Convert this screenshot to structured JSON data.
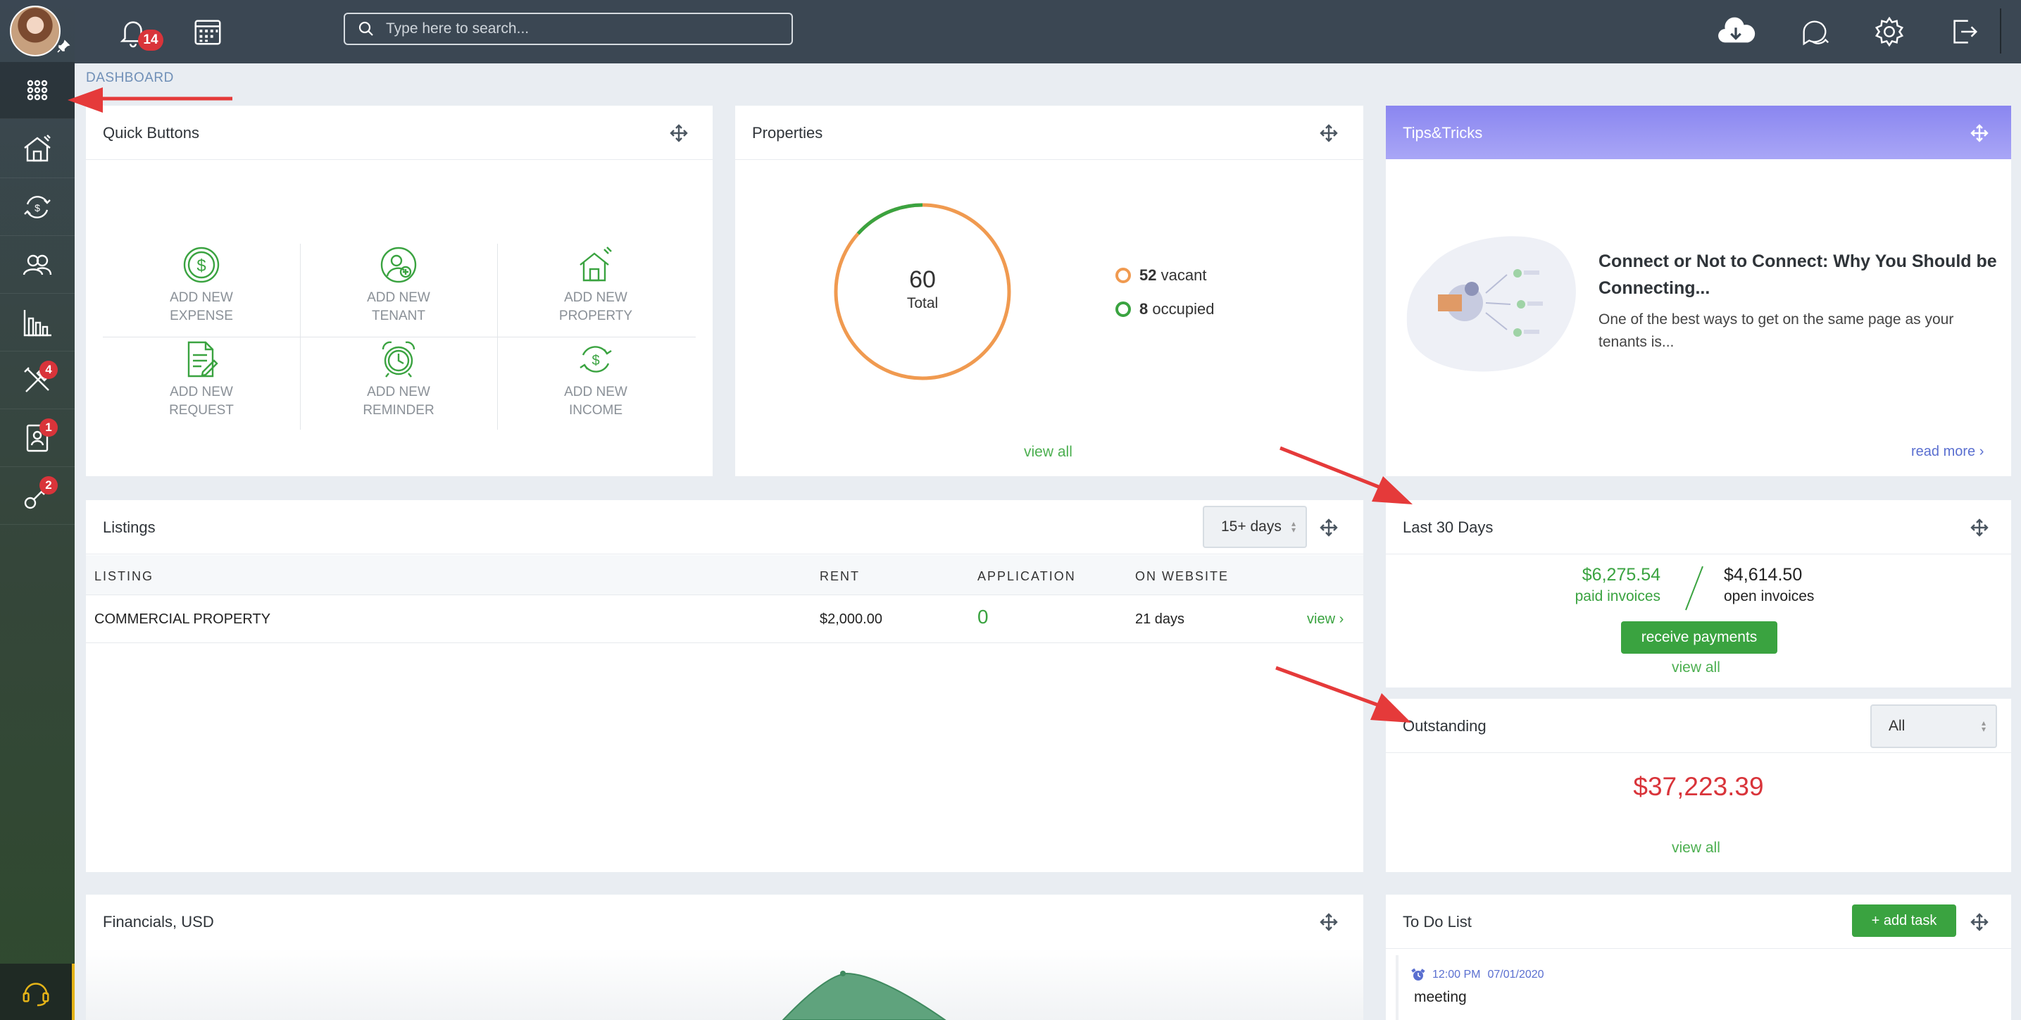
{
  "colors": {
    "accent_green": "#3aa340",
    "alert_red": "#d9343a",
    "vacant_orange": "#f09a50",
    "sidebar": "#3b4753"
  },
  "topbar": {
    "notification_count": "14",
    "search_placeholder": "Type here to search..."
  },
  "sidebar": {
    "items": [
      {
        "icon": "apps-grid-icon",
        "badge": ""
      },
      {
        "icon": "home-icon",
        "badge": ""
      },
      {
        "icon": "money-exchange-icon",
        "badge": ""
      },
      {
        "icon": "people-icon",
        "badge": ""
      },
      {
        "icon": "bar-chart-icon",
        "badge": ""
      },
      {
        "icon": "tools-icon",
        "badge": "4"
      },
      {
        "icon": "contact-card-icon",
        "badge": "1"
      },
      {
        "icon": "key-icon",
        "badge": "2"
      }
    ]
  },
  "breadcrumb": "DASHBOARD",
  "quick_buttons": {
    "title": "Quick Buttons",
    "items": [
      {
        "line1": "ADD NEW",
        "line2": "EXPENSE",
        "icon": "dollar-circle-icon"
      },
      {
        "line1": "ADD NEW",
        "line2": "TENANT",
        "icon": "add-user-icon"
      },
      {
        "line1": "ADD NEW",
        "line2": "PROPERTY",
        "icon": "add-house-icon"
      },
      {
        "line1": "ADD NEW",
        "line2": "REQUEST",
        "icon": "request-form-icon"
      },
      {
        "line1": "ADD NEW",
        "line2": "REMINDER",
        "icon": "alarm-clock-icon"
      },
      {
        "line1": "ADD NEW",
        "line2": "INCOME",
        "icon": "income-cycle-icon"
      }
    ]
  },
  "properties": {
    "title": "Properties",
    "total_value": "60",
    "total_label": "Total",
    "vacant_count": "52",
    "vacant_label": "vacant",
    "occupied_count": "8",
    "occupied_label": "occupied",
    "occupied_fraction": 0.1333,
    "view_all": "view all"
  },
  "tips": {
    "title": "Tips&Tricks",
    "headline": "Connect or Not to Connect: Why You Should be Connecting...",
    "body": "One of the best ways to get on the same page as your tenants is...",
    "read_more": "read more"
  },
  "listings": {
    "title": "Listings",
    "filter": "15+ days",
    "columns": [
      "LISTING",
      "RENT",
      "APPLICATION",
      "ON WEBSITE"
    ],
    "rows": [
      {
        "listing": "COMMERCIAL PROPERTY",
        "rent": "$2,000.00",
        "application": "0",
        "on_website": "21 days",
        "action": "view"
      }
    ]
  },
  "last30": {
    "title": "Last 30 Days",
    "paid_amount": "$6,275.54",
    "paid_label": "paid invoices",
    "open_amount": "$4,614.50",
    "open_label": "open invoices",
    "button": "receive payments",
    "view_all": "view all"
  },
  "outstanding": {
    "title": "Outstanding",
    "filter": "All",
    "amount": "$37,223.39",
    "view_all": "view all"
  },
  "financials": {
    "title": "Financials, USD"
  },
  "todo": {
    "title": "To Do List",
    "add_button": "+ add task",
    "items": [
      {
        "time": "12:00 PM",
        "date": "07/01/2020",
        "text": "meeting"
      }
    ]
  }
}
